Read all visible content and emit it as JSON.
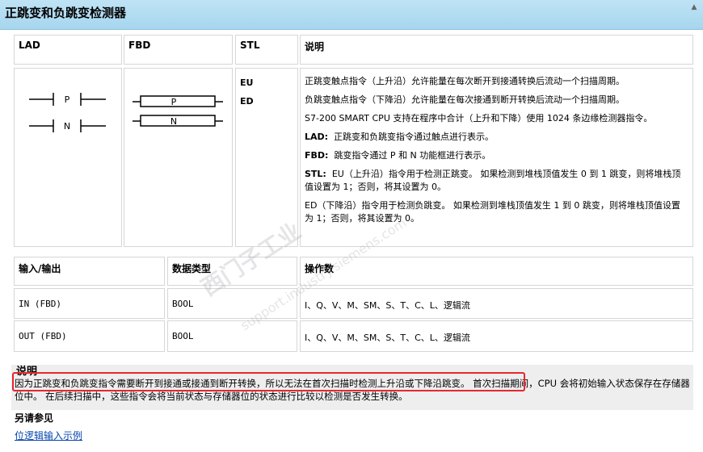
{
  "title": "正跳变和负跳变检测器",
  "table1": {
    "headers": [
      "LAD",
      "FBD",
      "STL",
      "说明"
    ],
    "lad": {
      "contact1": "P",
      "contact2": "N"
    },
    "fbd": {
      "box1": "P",
      "box2": "N"
    },
    "stl": [
      "EU",
      "ED"
    ],
    "desc": {
      "p1": "正跳变触点指令（上升沿）允许能量在每次断开到接通转换后流动一个扫描周期。",
      "p2": "负跳变触点指令（下降沿）允许能量在每次接通到断开转换后流动一个扫描周期。",
      "p3": "S7-200 SMART CPU 支持在程序中合计（上升和下降）使用 1024 条边缘检测器指令。",
      "p4_label": "LAD:",
      "p4": "正跳变和负跳变指令通过触点进行表示。",
      "p5_label": "FBD:",
      "p5": "跳变指令通过 P 和 N 功能框进行表示。",
      "p6_label": "STL:",
      "p6": "EU（上升沿）指令用于检测正跳变。 如果检测到堆栈顶值发生 0 到 1 跳变，则将堆栈顶值设置为 1；否则，将其设置为 0。",
      "p7": "ED（下降沿）指令用于检测负跳变。 如果检测到堆栈顶值发生 1 到 0 跳变，则将堆栈顶值设置为 1；否则，将其设置为 0。"
    }
  },
  "table2": {
    "headers": [
      "输入/输出",
      "数据类型",
      "操作数"
    ],
    "rows": [
      [
        "IN (FBD)",
        "BOOL",
        "I、Q、V、M、SM、S、T、C、L、逻辑流"
      ],
      [
        "OUT (FBD)",
        "BOOL",
        "I、Q、V、M、SM、S、T、C、L、逻辑流"
      ]
    ]
  },
  "note": {
    "title": "说明",
    "highlighted": "因为正跳变和负跳变指令需要断开到接通或接通到断开转换，所以无法在首次扫描时检测上升沿或下降沿跳变。",
    "rest": " 首次扫描期间，CPU 会将初始输入状态保存在存储器位中。 在后续扫描中，这些指令会将当前状态与存储器位的状态进行比较以检测是否发生转换。"
  },
  "see_also": {
    "title": "另请参见",
    "link": "位逻辑输入示例"
  },
  "watermark": {
    "line1": "西门子工业",
    "line2": "support.industry.siemens.com"
  },
  "colors": {
    "titlebar": "#a6d6ee",
    "highlight": "#e8262f",
    "link": "#0645ad"
  }
}
